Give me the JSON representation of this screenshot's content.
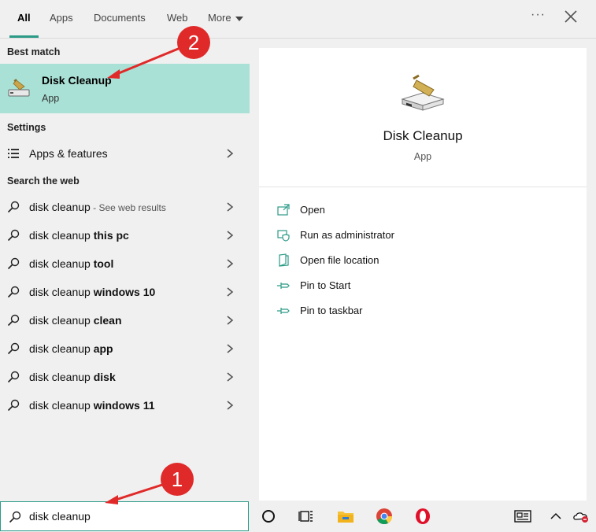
{
  "tabs": [
    {
      "label": "All",
      "active": true
    },
    {
      "label": "Apps"
    },
    {
      "label": "Documents"
    },
    {
      "label": "Web"
    },
    {
      "label": "More"
    }
  ],
  "results": {
    "best_match_header": "Best match",
    "best_match": {
      "title": "Disk Cleanup",
      "subtitle": "App",
      "icon": "disk-cleanup-icon"
    },
    "settings_header": "Settings",
    "settings_item": {
      "label": "Apps & features",
      "icon": "apps-features-icon"
    },
    "web_header": "Search the web",
    "web_items": [
      {
        "prefix": "disk cleanup",
        "bold": "",
        "hint": " - See web results"
      },
      {
        "prefix": "disk cleanup ",
        "bold": "this pc",
        "hint": ""
      },
      {
        "prefix": "disk cleanup ",
        "bold": "tool",
        "hint": ""
      },
      {
        "prefix": "disk cleanup ",
        "bold": "windows 10",
        "hint": ""
      },
      {
        "prefix": "disk cleanup ",
        "bold": "clean",
        "hint": ""
      },
      {
        "prefix": "disk cleanup ",
        "bold": "app",
        "hint": ""
      },
      {
        "prefix": "disk cleanup ",
        "bold": "disk",
        "hint": ""
      },
      {
        "prefix": "disk cleanup ",
        "bold": "windows 11",
        "hint": ""
      }
    ]
  },
  "preview": {
    "title": "Disk Cleanup",
    "subtitle": "App",
    "actions": [
      {
        "label": "Open",
        "icon": "open-icon"
      },
      {
        "label": "Run as administrator",
        "icon": "shield-icon"
      },
      {
        "label": "Open file location",
        "icon": "file-location-icon"
      },
      {
        "label": "Pin to Start",
        "icon": "pin-icon"
      },
      {
        "label": "Pin to taskbar",
        "icon": "pin-icon"
      }
    ]
  },
  "search": {
    "value": "disk cleanup"
  },
  "annotations": {
    "badge_1": "1",
    "badge_2": "2"
  },
  "colors": {
    "accent": "#2b9a87",
    "selection": "#a9e1d6",
    "annotation": "#e02a2a"
  }
}
